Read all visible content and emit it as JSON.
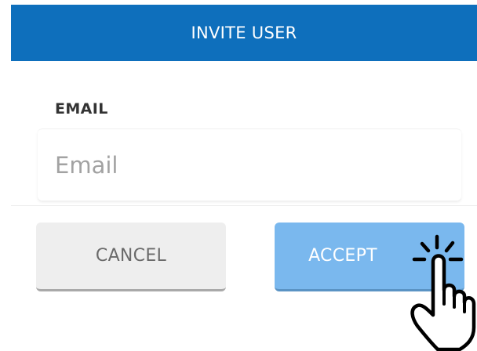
{
  "dialog": {
    "title": "INVITE USER"
  },
  "form": {
    "email_label": "EMAIL",
    "email_placeholder": "Email",
    "email_value": ""
  },
  "actions": {
    "cancel_label": "CANCEL",
    "accept_label": "ACCEPT"
  },
  "icons": {
    "pointer": "tap-hand-icon"
  },
  "colors": {
    "header": "#0e6fbc",
    "accept": "#7ab8ee",
    "cancel": "#eeeeee"
  }
}
